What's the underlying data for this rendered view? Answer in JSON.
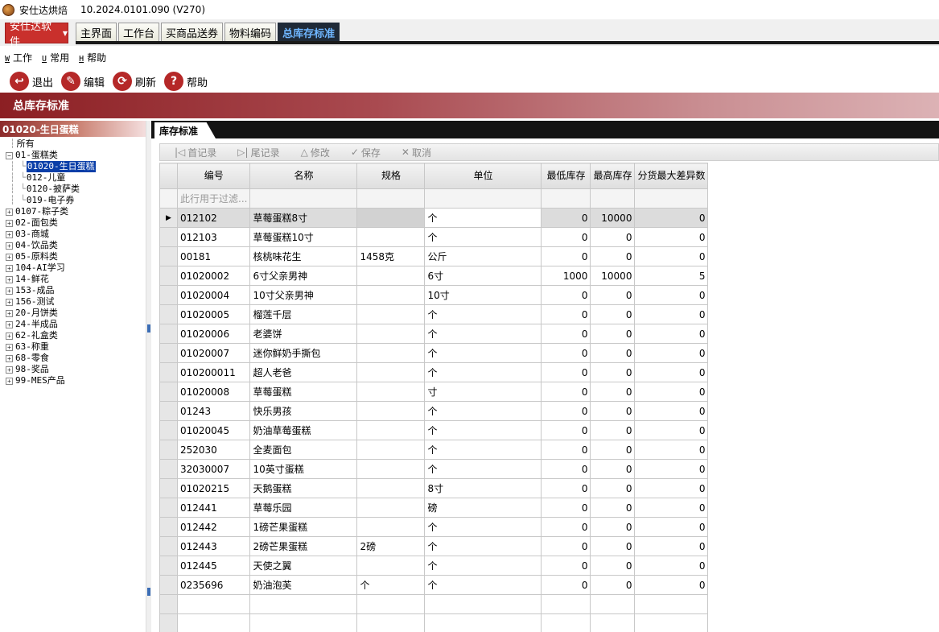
{
  "window": {
    "app_name": "安仕达烘焙",
    "version": "10.2024.0101.090 (V270)"
  },
  "brand_button": {
    "label": "安仕达软件"
  },
  "tabs": [
    "主界面",
    "工作台",
    "买商品送券",
    "物料编码",
    "总库存标准"
  ],
  "active_tab": "总库存标准",
  "menu": [
    {
      "key": "W",
      "label": "工作"
    },
    {
      "key": "U",
      "label": "常用"
    },
    {
      "key": "H",
      "label": "帮助"
    }
  ],
  "toolbar": [
    {
      "label": "退出",
      "icon": "exit-icon"
    },
    {
      "label": "编辑",
      "icon": "edit-icon"
    },
    {
      "label": "刷新",
      "icon": "refresh-icon"
    },
    {
      "label": "帮助",
      "icon": "help-icon"
    }
  ],
  "banner": {
    "title": "总库存标准"
  },
  "left_panel": {
    "header": "01020-生日蛋糕",
    "tree": [
      {
        "label": "所有",
        "level": 0,
        "expander": ""
      },
      {
        "label": "01-蛋糕类",
        "level": 0,
        "expander": "−"
      },
      {
        "label": "01020-生日蛋糕",
        "level": 1,
        "expander": "",
        "selected": true
      },
      {
        "label": "012-儿童",
        "level": 1,
        "expander": ""
      },
      {
        "label": "0120-披萨类",
        "level": 1,
        "expander": ""
      },
      {
        "label": "019-电子券",
        "level": 1,
        "expander": ""
      },
      {
        "label": "0107-粽子类",
        "level": 0,
        "expander": "+"
      },
      {
        "label": "02-面包类",
        "level": 0,
        "expander": "+"
      },
      {
        "label": "03-商城",
        "level": 0,
        "expander": "+"
      },
      {
        "label": "04-饮品类",
        "level": 0,
        "expander": "+"
      },
      {
        "label": "05-原料类",
        "level": 0,
        "expander": "+"
      },
      {
        "label": "104-AI学习",
        "level": 0,
        "expander": "+"
      },
      {
        "label": "14-鲜花",
        "level": 0,
        "expander": "+"
      },
      {
        "label": "153-成品",
        "level": 0,
        "expander": "+"
      },
      {
        "label": "156-测试",
        "level": 0,
        "expander": "+"
      },
      {
        "label": "20-月饼类",
        "level": 0,
        "expander": "+"
      },
      {
        "label": "24-半成品",
        "level": 0,
        "expander": "+"
      },
      {
        "label": "62-礼盒类",
        "level": 0,
        "expander": "+"
      },
      {
        "label": "63-称重",
        "level": 0,
        "expander": "+"
      },
      {
        "label": "68-零食",
        "level": 0,
        "expander": "+"
      },
      {
        "label": "98-奖品",
        "level": 0,
        "expander": "+"
      },
      {
        "label": "99-MES产品",
        "level": 0,
        "expander": "+"
      }
    ]
  },
  "right_panel": {
    "tab": "库存标准",
    "nav": [
      {
        "label": "首记录",
        "icon": "first-record-icon",
        "glyph": "|◁"
      },
      {
        "label": "尾记录",
        "icon": "last-record-icon",
        "glyph": "▷|"
      },
      {
        "label": "修改",
        "icon": "modify-icon",
        "glyph": "△"
      },
      {
        "label": "保存",
        "icon": "save-icon",
        "glyph": "✓"
      },
      {
        "label": "取消",
        "icon": "cancel-icon",
        "glyph": "✕"
      }
    ],
    "grid": {
      "columns": [
        "编号",
        "名称",
        "规格",
        "单位",
        "最低库存",
        "最高库存",
        "分货最大差异数"
      ],
      "filter_placeholder": "此行用于过滤...",
      "current_row": 0,
      "rows": [
        [
          "012102",
          "草莓蛋糕8寸",
          "",
          "个",
          "0",
          "10000",
          "0"
        ],
        [
          "012103",
          "草莓蛋糕10寸",
          "",
          "个",
          "0",
          "0",
          "0"
        ],
        [
          "00181",
          "核桃味花生",
          "1458克",
          "公斤",
          "0",
          "0",
          "0"
        ],
        [
          "01020002",
          "6寸父亲男神",
          "",
          "6寸",
          "1000",
          "10000",
          "5"
        ],
        [
          "01020004",
          "10寸父亲男神",
          "",
          "10寸",
          "0",
          "0",
          "0"
        ],
        [
          "01020005",
          "榴莲千层",
          "",
          "个",
          "0",
          "0",
          "0"
        ],
        [
          "01020006",
          "老婆饼",
          "",
          "个",
          "0",
          "0",
          "0"
        ],
        [
          "01020007",
          "迷你鲜奶手撕包",
          "",
          "个",
          "0",
          "0",
          "0"
        ],
        [
          "010200011",
          "超人老爸",
          "",
          "个",
          "0",
          "0",
          "0"
        ],
        [
          "01020008",
          "草莓蛋糕",
          "",
          "寸",
          "0",
          "0",
          "0"
        ],
        [
          "01243",
          "快乐男孩",
          "",
          "个",
          "0",
          "0",
          "0"
        ],
        [
          "01020045",
          "奶油草莓蛋糕",
          "",
          "个",
          "0",
          "0",
          "0"
        ],
        [
          "252030",
          "全麦面包",
          "",
          "个",
          "0",
          "0",
          "0"
        ],
        [
          "32030007",
          "10英寸蛋糕",
          "",
          "个",
          "0",
          "0",
          "0"
        ],
        [
          "01020215",
          "天鹅蛋糕",
          "",
          "8寸",
          "0",
          "0",
          "0"
        ],
        [
          "012441",
          "草莓乐园",
          "",
          "磅",
          "0",
          "0",
          "0"
        ],
        [
          "012442",
          "1磅芒果蛋糕",
          "",
          "个",
          "0",
          "0",
          "0"
        ],
        [
          "012443",
          "2磅芒果蛋糕",
          "2磅",
          "个",
          "0",
          "0",
          "0"
        ],
        [
          "012445",
          "天使之翼",
          "",
          "个",
          "0",
          "0",
          "0"
        ],
        [
          "0235696",
          "奶油泡芙",
          "个",
          "个",
          "0",
          "0",
          "0"
        ]
      ]
    }
  }
}
